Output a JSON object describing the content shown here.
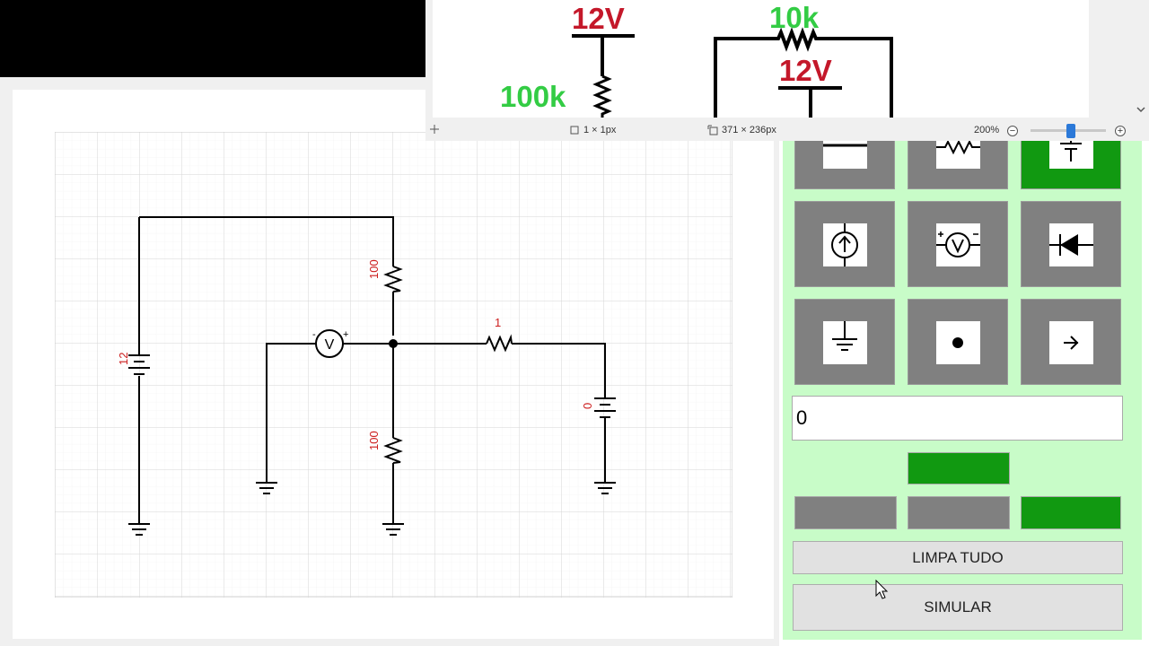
{
  "preview": {
    "labels": [
      {
        "id": "top-left-voltage",
        "text": "12V",
        "color": "#c4182a"
      },
      {
        "id": "left-resistor",
        "text": "100k",
        "color": "#33cc44"
      },
      {
        "id": "top-right-resistor",
        "text": "10k",
        "color": "#33cc44"
      },
      {
        "id": "right-voltage",
        "text": "12V",
        "color": "#c4182a"
      }
    ],
    "status": {
      "cursor_size": "1 × 1px",
      "selection_size": "371 × 236px",
      "zoom": "200%"
    }
  },
  "circuit": {
    "battery_left_value": "12",
    "resistor_top_value": "100",
    "resistor_bottom_value": "100",
    "resistor_series_value": "1",
    "battery_right_value": "0",
    "voltmeter_symbol": "V",
    "voltmeter_minus": "-",
    "voltmeter_plus": "+",
    "label_color": "#cc1c1c"
  },
  "tools": {
    "value_input": "0",
    "clear_all_label": "LIMPA TUDO",
    "simulate_label": "SIMULAR",
    "active_color": "#119911",
    "inactive_color": "#808080",
    "panel_color": "#c8fcc8"
  }
}
